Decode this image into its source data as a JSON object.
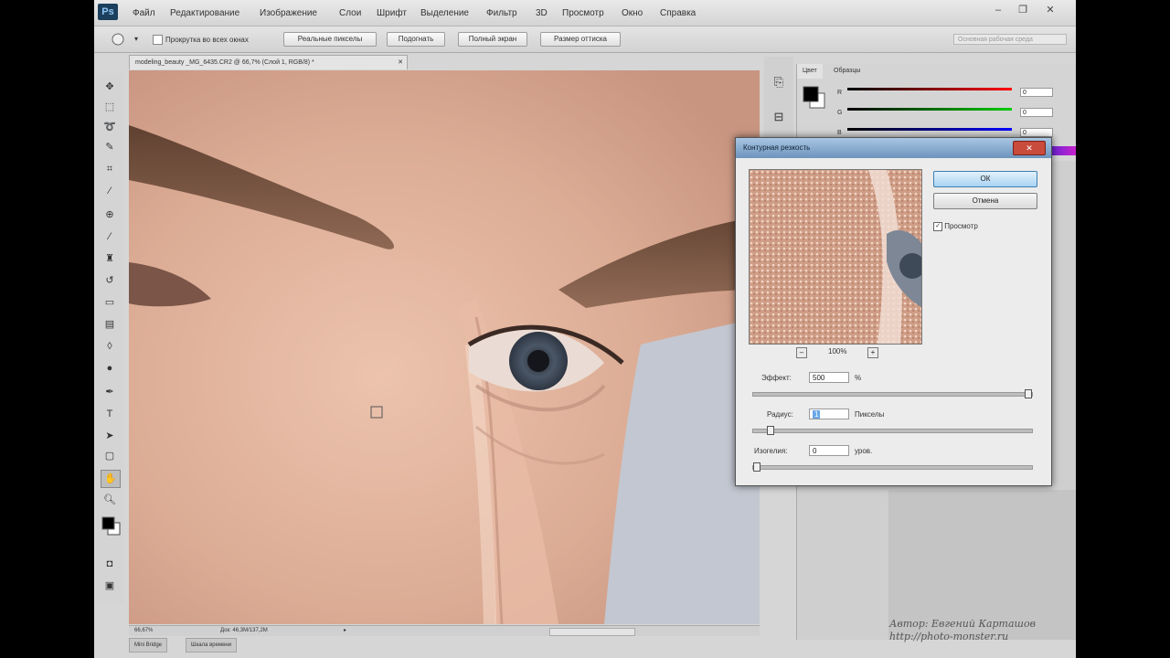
{
  "app": {
    "logo": "Ps"
  },
  "menu": [
    "Файл",
    "Редактирование",
    "Изображение",
    "Слои",
    "Шрифт",
    "Выделение",
    "Фильтр",
    "3D",
    "Просмотр",
    "Окно",
    "Справка"
  ],
  "window_buttons": {
    "minimize": "–",
    "restore": "❐",
    "close": "✕"
  },
  "options": {
    "all_windows_label": "Прокрутка во всех окнах",
    "buttons": [
      "Реальные пикселы",
      "Подогнать",
      "Полный экран",
      "Размер оттиска"
    ],
    "workspace": "Основная рабочая среда"
  },
  "document": {
    "tab_title": "modeling_beauty _MG_6435.CR2 @ 66,7% (Слой 1, RGB/8) *",
    "zoom": "66,67%",
    "doc_info": "Док: 46,3M/137,2M"
  },
  "bottom_tabs": [
    "Mini Bridge",
    "Шкала времени"
  ],
  "color_panel": {
    "tabs": [
      "Цвет",
      "Образцы"
    ],
    "channels": [
      {
        "label": "R",
        "value": "0"
      },
      {
        "label": "G",
        "value": "0"
      },
      {
        "label": "B",
        "value": "0"
      }
    ]
  },
  "dialog": {
    "title": "Контурная резкость",
    "ok": "ОК",
    "cancel": "Отмена",
    "preview_label": "Просмотр",
    "preview_checked": true,
    "zoom_level": "100%",
    "zoom_out": "–",
    "zoom_in": "+",
    "effect_label": "Эффект:",
    "effect_value": "500",
    "effect_unit": "%",
    "effect_level": 1.0,
    "radius_label": "Радиус:",
    "radius_value": "1",
    "radius_unit": "Пикселы",
    "radius_level": 0.05,
    "threshold_label": "Изогелия:",
    "threshold_value": "0",
    "threshold_unit": "уров.",
    "threshold_level": 0.0
  },
  "watermark": {
    "line1": "Автор: Евгений Карташов",
    "line2": "http://photo-monster.ru"
  },
  "colors": {
    "skin": "#d9ac97",
    "background_sky": "#c2c6d0",
    "ok_blue": "#a9d4f3",
    "close_red": "#c84b3c"
  }
}
